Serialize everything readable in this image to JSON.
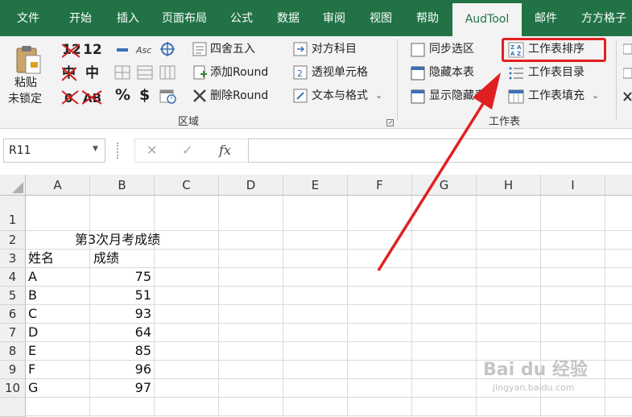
{
  "tabs": [
    "文件",
    "开始",
    "插入",
    "页面布局",
    "公式",
    "数据",
    "审阅",
    "视图",
    "帮助",
    "AudTool",
    "邮件",
    "方方格子"
  ],
  "active_tab": "AudTool",
  "ribbon": {
    "paste_line1": "粘贴",
    "paste_line2": "未锁定",
    "num_top": "12",
    "char_zhong": "中",
    "percent": "%",
    "dollar": "$",
    "asc": "Asc",
    "round_items": [
      "四舍五入",
      "添加Round",
      "删除Round"
    ],
    "subject_items": [
      "对方科目",
      "透视单元格",
      "文本与格式"
    ],
    "area_group": "区域",
    "sheet_items": [
      "同步选区",
      "隐藏本表",
      "显示隐藏表"
    ],
    "sheet_items2": [
      "工作表排序",
      "工作表目录",
      "工作表填充"
    ],
    "sheet_group": "工作表",
    "sort_az_top": "Z A",
    "sort_az_bottom": "A Z"
  },
  "formula_bar": {
    "name_box": "R11",
    "cancel_icon": "✕",
    "enter_icon": "✓",
    "fx_label": "fx",
    "formula": ""
  },
  "grid": {
    "columns": [
      "A",
      "B",
      "C",
      "D",
      "E",
      "F",
      "G",
      "H",
      "I"
    ],
    "rows": [
      "1",
      "2",
      "3",
      "4",
      "5",
      "6",
      "7",
      "8",
      "9",
      "10"
    ],
    "title": "第3次月考成绩",
    "header_name": "姓名",
    "header_score": "成绩",
    "names": [
      "A",
      "B",
      "C",
      "D",
      "E",
      "F",
      "G"
    ],
    "scores": [
      "75",
      "51",
      "93",
      "64",
      "85",
      "96",
      "97"
    ]
  },
  "watermark": {
    "brand": "Bai du 经验",
    "url": "jingyan.baidu.com"
  },
  "colors": {
    "accent": "#217346",
    "highlight": "#e02020"
  }
}
